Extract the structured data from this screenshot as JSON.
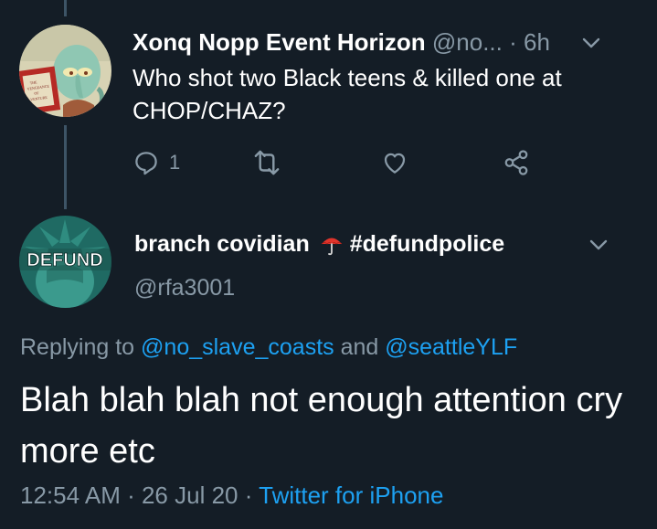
{
  "parent_tweet": {
    "display_name": "Xonq Nopp Event Horizon",
    "handle": "@no...",
    "separator": " · ",
    "time": "6h",
    "text": "Who shot two Black teens & killed one at CHOP/CHAZ?",
    "avatar_book_text": "THE VENGEANCE OF VENTURE",
    "reply_count": "1",
    "icons": {
      "reply": "reply-icon",
      "retweet": "retweet-icon",
      "like": "heart-icon",
      "share": "share-icon",
      "menu": "chevron-down-icon"
    }
  },
  "main_tweet": {
    "display_name": "branch covidian",
    "emoji": "umbrella-emoji",
    "hashtag": "#defundpolice",
    "handle": "@rfa3001",
    "avatar_text": "DEFUND",
    "replying_prefix": "Replying to ",
    "replying_user_1": "@no_slave_coasts",
    "replying_and": " and ",
    "replying_user_2": "@seattleYLF",
    "text": "Blah blah blah not enough attention cry more etc",
    "time": "12:54 AM",
    "sep": " · ",
    "date": "26 Jul 20",
    "source": "Twitter for iPhone"
  },
  "colors": {
    "background": "#141d26",
    "secondary_text": "#8899a6",
    "link": "#1da1f2",
    "thread_line": "#3d5466"
  }
}
